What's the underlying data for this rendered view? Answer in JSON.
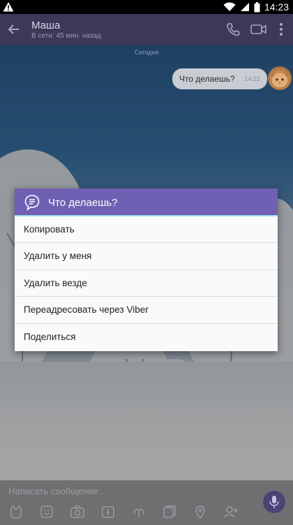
{
  "status_bar": {
    "time": "14:23"
  },
  "header": {
    "contact_name": "Маша",
    "last_seen": "В сети: 45 мин. назад"
  },
  "chat": {
    "date_separator": "Сегодня",
    "messages": [
      {
        "text": "Что делаешь?",
        "time": "14:22"
      }
    ]
  },
  "dialog": {
    "title": "Что делаешь?",
    "items": [
      {
        "label": "Копировать"
      },
      {
        "label": "Удалить у меня"
      },
      {
        "label": "Удалить везде"
      },
      {
        "label": "Переадресовать через Viber"
      },
      {
        "label": "Поделиться"
      }
    ]
  },
  "input": {
    "placeholder": "Написать сообщение..."
  },
  "colors": {
    "header_bg": "#3b3957",
    "dialog_header": "#7060b3",
    "accent": "#9adbe8"
  }
}
